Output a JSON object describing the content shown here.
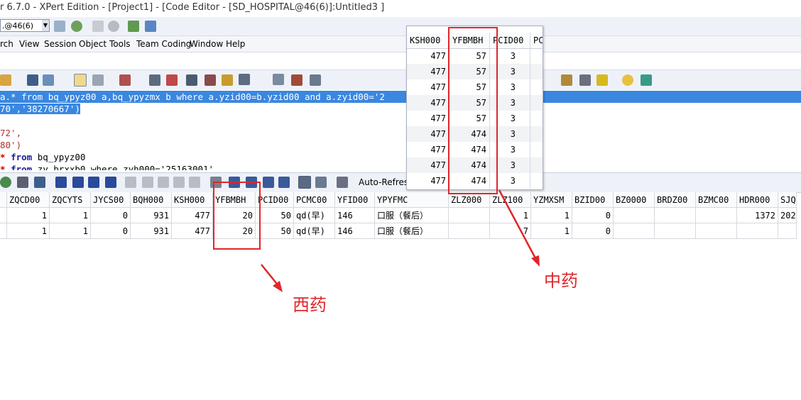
{
  "window": {
    "title": "r 6.7.0 - XPert Edition - [Project1] - [Code Editor - [SD_HOSPITAL@46(6)]:Untitled3 ]"
  },
  "toolbar": {
    "session_value": ".@46(6)"
  },
  "menu": [
    "rch",
    "View",
    "Session",
    "Object",
    "Tools",
    "Team Coding",
    "Window",
    "Help"
  ],
  "editor": {
    "lines": [
      {
        "a": "a.* ",
        "b": "from",
        "c": " bq_ypyz00 a,bq_ypyzmx b ",
        "d": "where",
        "e": " a.yzid00=b.yzid00 ",
        "f": "and",
        "g": " a.zyid00='2"
      },
      {
        "a": "70','38270667')"
      },
      {
        "a": ""
      },
      {
        "a": "72',"
      },
      {
        "a": "80')"
      },
      {
        "a": "* ",
        "b": "from",
        "c": " bq_ypyz00"
      },
      {
        "a": "* ",
        "b": "from",
        "c": " zy_brxxb0 where zyh000='25163001'"
      }
    ]
  },
  "grid_toolbar": {
    "auto_refresh": "Auto-Refres"
  },
  "main_grid": {
    "columns": [
      "",
      "ZQCD00",
      "ZQCYTS",
      "JYCS00",
      "BQH000",
      "KSH000",
      "YFBMBH",
      "PCID00",
      "PCMC00",
      "YFID00",
      "YPYFMC",
      "ZLZ000",
      "ZLZ100",
      "YZMXSM",
      "BZID00",
      "BZ0000",
      "BRDZ00",
      "BZMC00",
      "HDR000",
      "SJQ"
    ],
    "rows": [
      [
        "",
        "1",
        "1",
        "0",
        "931",
        "477",
        "20",
        "50",
        "qd(早)",
        "146",
        "口服（餐后）",
        "",
        "1",
        "1",
        "0",
        "",
        "",
        "",
        "1372",
        "202"
      ],
      [
        "",
        "1",
        "1",
        "0",
        "931",
        "477",
        "20",
        "50",
        "qd(早)",
        "146",
        "口服（餐后）",
        "",
        "7",
        "1",
        "0",
        "",
        "",
        "",
        "",
        ""
      ]
    ]
  },
  "popup_grid": {
    "columns": [
      "KSH000",
      "YFBMBH",
      "PCID00",
      "PC"
    ],
    "rows": [
      [
        "477",
        "57",
        "3",
        ""
      ],
      [
        "477",
        "57",
        "3",
        ""
      ],
      [
        "477",
        "57",
        "3",
        ""
      ],
      [
        "477",
        "57",
        "3",
        ""
      ],
      [
        "477",
        "57",
        "3",
        ""
      ],
      [
        "477",
        "474",
        "3",
        ""
      ],
      [
        "477",
        "474",
        "3",
        ""
      ],
      [
        "477",
        "474",
        "3",
        ""
      ],
      [
        "477",
        "474",
        "3",
        ""
      ]
    ]
  },
  "annotations": {
    "western_medicine": "西药",
    "chinese_medicine": "中药"
  },
  "colors": {
    "annotation_red": "#e0262a",
    "selection_blue": "#3a87e0"
  }
}
